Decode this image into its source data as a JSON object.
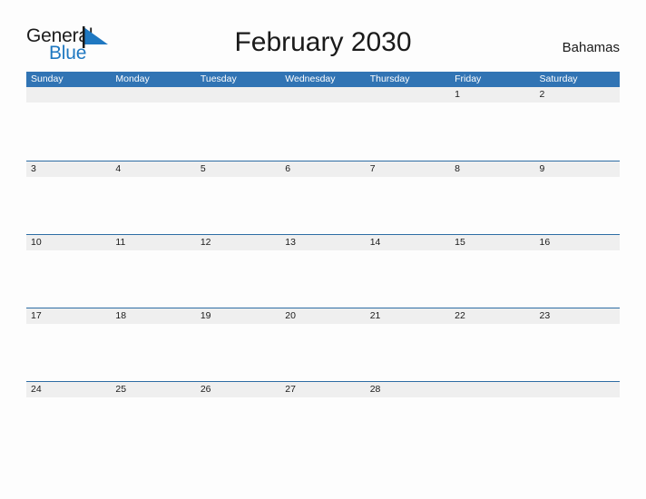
{
  "brand": {
    "name_part1": "General",
    "name_part2": "Blue",
    "flag_icon": "flag-triangle-icon",
    "flag_color": "#1f78c1"
  },
  "header": {
    "title": "February 2030",
    "country": "Bahamas"
  },
  "colors": {
    "header_blue": "#3174b4",
    "rule_blue": "#2e6da4",
    "date_band_gray": "#efefef",
    "page_background": "#fdfdfd",
    "text_dark": "#1a1a1a",
    "brand_blue": "#1f78c1"
  },
  "calendar": {
    "weekdays": [
      "Sunday",
      "Monday",
      "Tuesday",
      "Wednesday",
      "Thursday",
      "Friday",
      "Saturday"
    ],
    "weeks": [
      {
        "days": [
          "",
          "",
          "",
          "",
          "",
          "1",
          "2"
        ]
      },
      {
        "days": [
          "3",
          "4",
          "5",
          "6",
          "7",
          "8",
          "9"
        ]
      },
      {
        "days": [
          "10",
          "11",
          "12",
          "13",
          "14",
          "15",
          "16"
        ]
      },
      {
        "days": [
          "17",
          "18",
          "19",
          "20",
          "21",
          "22",
          "23"
        ]
      },
      {
        "days": [
          "24",
          "25",
          "26",
          "27",
          "28",
          "",
          ""
        ]
      }
    ]
  }
}
